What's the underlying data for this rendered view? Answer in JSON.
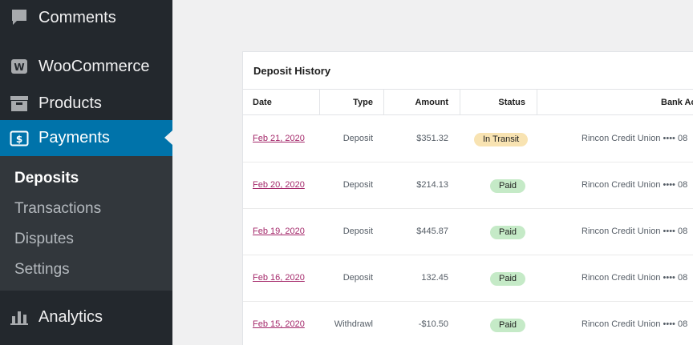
{
  "sidebar": {
    "items": [
      {
        "label": "Comments",
        "icon": "comment-icon"
      },
      {
        "label": "WooCommerce",
        "icon": "woocommerce-icon"
      },
      {
        "label": "Products",
        "icon": "archive-icon"
      },
      {
        "label": "Payments",
        "icon": "payments-icon"
      },
      {
        "label": "Analytics",
        "icon": "bar-chart-icon"
      }
    ],
    "submenu": [
      "Deposits",
      "Transactions",
      "Disputes",
      "Settings"
    ],
    "current_sub": "Deposits"
  },
  "colors": {
    "sidebar_bg": "#23282d",
    "submenu_bg": "#32373c",
    "active_bg": "#0073aa",
    "link": "#a4286a",
    "badge_transit": "#f8e3b2",
    "badge_paid": "#c5eac7"
  },
  "card": {
    "title": "Deposit History",
    "columns": [
      "Date",
      "Type",
      "Amount",
      "Status",
      "Bank Ac"
    ],
    "rows": [
      {
        "date": "Feb 21, 2020",
        "type": "Deposit",
        "amount": "$351.32",
        "status": "In Transit",
        "bank": "Rincon Credit Union •••• 08"
      },
      {
        "date": "Feb 20, 2020",
        "type": "Deposit",
        "amount": "$214.13",
        "status": "Paid",
        "bank": "Rincon Credit Union •••• 08"
      },
      {
        "date": "Feb 19, 2020",
        "type": "Deposit",
        "amount": "$445.87",
        "status": "Paid",
        "bank": "Rincon Credit Union •••• 08"
      },
      {
        "date": "Feb 16, 2020",
        "type": "Deposit",
        "amount": "132.45",
        "status": "Paid",
        "bank": "Rincon Credit Union •••• 08"
      },
      {
        "date": "Feb 15, 2020",
        "type": "Withdrawl",
        "amount": "-$10.50",
        "status": "Paid",
        "bank": "Rincon Credit Union •••• 08"
      }
    ]
  }
}
